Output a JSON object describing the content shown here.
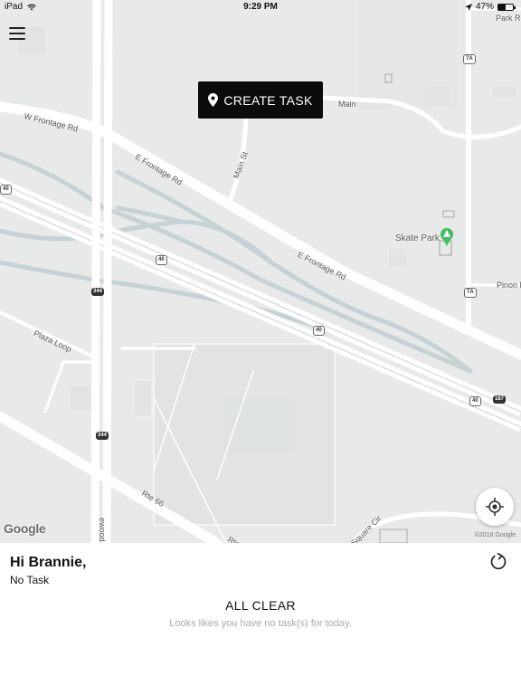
{
  "status_bar": {
    "device": "iPad",
    "time": "9:29 PM",
    "battery": "47%",
    "battery_level": 0.47,
    "icons": [
      "wifi-icon",
      "location-arrow-icon",
      "battery-icon"
    ]
  },
  "map": {
    "labels": {
      "w_frontage": "W Frontage Rd",
      "e_frontage_1": "E Frontage Rd",
      "e_frontage_2": "E Frontage Rd",
      "main": "Main",
      "main_st": "Main St",
      "park_rd": "Park Rd",
      "skate_park": "Skate Park",
      "pinon": "Pinon F",
      "plaza_loop": "Plaza Loop",
      "rte66": "Rte 66",
      "rte": "Rte",
      "square_cir": "Square Cir",
      "lower_road": "ewood"
    },
    "shields": {
      "i40_a": "40",
      "i40_b": "40",
      "i40_c": "40",
      "i40_d": "40",
      "i40_e": "40",
      "r344_a": "344",
      "r344_b": "344",
      "r187": "187",
      "r7a_a": "7A",
      "r7a_b": "7A"
    },
    "google": "Google",
    "copyright": "©2018 Google",
    "colors": {
      "background": "#e8eaea",
      "road": "#ffffff",
      "highway": "#c7d2d4",
      "park_pin": "#3fbf63"
    }
  },
  "menu": {
    "icon": "hamburger-menu-icon"
  },
  "create_task": {
    "label": "CREATE TASK",
    "icon": "map-pin-icon",
    "background": "#0b0b0b"
  },
  "locate": {
    "icon": "crosshair-icon"
  },
  "panel": {
    "greeting": "Hi Brannie,",
    "task_status": "No Task",
    "refresh_icon": "refresh-icon",
    "title": "ALL CLEAR",
    "message": "Looks likes you have no task(s) for today."
  }
}
